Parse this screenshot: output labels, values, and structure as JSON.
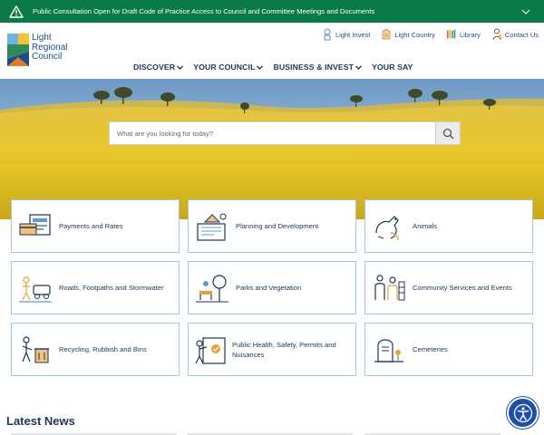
{
  "alert": {
    "message": "Public Consultation Open for Draft Code of Practice Access to Council and Committee Meetings and Documents",
    "icon": "warning-icon",
    "toggle_icon": "chevron-down-icon"
  },
  "logo": {
    "line1": "Light",
    "line2": "Regional",
    "line3": "Council"
  },
  "utility_links": [
    {
      "label": "Light Invest",
      "icon": "light-invest-icon"
    },
    {
      "label": "Light Country",
      "icon": "light-country-icon"
    },
    {
      "label": "Library",
      "icon": "library-icon"
    },
    {
      "label": "Contact Us",
      "icon": "contact-icon"
    }
  ],
  "main_nav": [
    {
      "label": "DISCOVER",
      "has_dropdown": true
    },
    {
      "label": "YOUR COUNCIL",
      "has_dropdown": true
    },
    {
      "label": "BUSINESS & INVEST",
      "has_dropdown": true
    },
    {
      "label": "YOUR SAY",
      "has_dropdown": false
    }
  ],
  "search": {
    "placeholder": "What are you looking for today?",
    "icon": "search-icon"
  },
  "tiles": [
    {
      "label": "Payments and Rates",
      "icon": "payments-icon"
    },
    {
      "label": "Planning and Development",
      "icon": "planning-icon"
    },
    {
      "label": "Animals",
      "icon": "animals-icon"
    },
    {
      "label": "Roads, Footpaths and Stormwater",
      "icon": "roads-icon"
    },
    {
      "label": "Parks and Vegetation",
      "icon": "parks-icon"
    },
    {
      "label": "Community Services and Events",
      "icon": "community-icon"
    },
    {
      "label": "Recycling, Rubbish and Bins",
      "icon": "recycling-icon"
    },
    {
      "label": "Public Health, Safety, Permits and Nuisances",
      "icon": "public-health-icon"
    },
    {
      "label": "Cemeteries",
      "icon": "cemeteries-icon"
    }
  ],
  "latest_news": {
    "heading": "Latest News"
  },
  "accessibility": {
    "icon": "accessibility-icon"
  },
  "colors": {
    "alert_bg": "#0b7a49",
    "brand_blue": "#1a4d8c",
    "nav_text": "#17365d",
    "tile_border": "#a6c4da",
    "accessibility_bg": "#1f4fa8"
  }
}
